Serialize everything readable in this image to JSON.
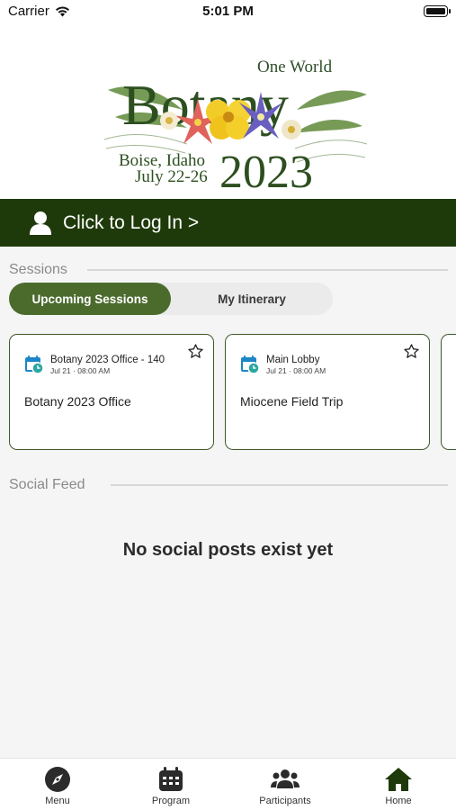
{
  "status_bar": {
    "carrier": "Carrier",
    "time": "5:01 PM"
  },
  "banner": {
    "logo_text": {
      "line1": "One World",
      "line2": "Botany",
      "place": "Boise, Idaho",
      "dates": "July 22-26",
      "year": "2023"
    }
  },
  "login": {
    "label": "Click to Log In >"
  },
  "sessions": {
    "title": "Sessions",
    "tabs": [
      {
        "label": "Upcoming Sessions",
        "selected": true
      },
      {
        "label": "My Itinerary",
        "selected": false
      }
    ],
    "cards": [
      {
        "room": "Botany 2023 Office - 140",
        "when": "Jul 21 · 08:00 AM",
        "name": "Botany 2023 Office"
      },
      {
        "room": "Main Lobby",
        "when": "Jul 21 · 08:00 AM",
        "name": "Miocene Field Trip"
      }
    ]
  },
  "social": {
    "title": "Social Feed",
    "empty_message": "No social posts exist yet"
  },
  "tabbar": {
    "items": [
      {
        "label": "Menu",
        "icon": "compass-icon"
      },
      {
        "label": "Program",
        "icon": "calendar-icon"
      },
      {
        "label": "Participants",
        "icon": "people-icon"
      },
      {
        "label": "Home",
        "icon": "home-icon",
        "active": true
      }
    ]
  },
  "colors": {
    "brand_dark": "#1e3a0a",
    "brand_green": "#4b6b2d",
    "calendar_blue": "#1c86c6"
  }
}
